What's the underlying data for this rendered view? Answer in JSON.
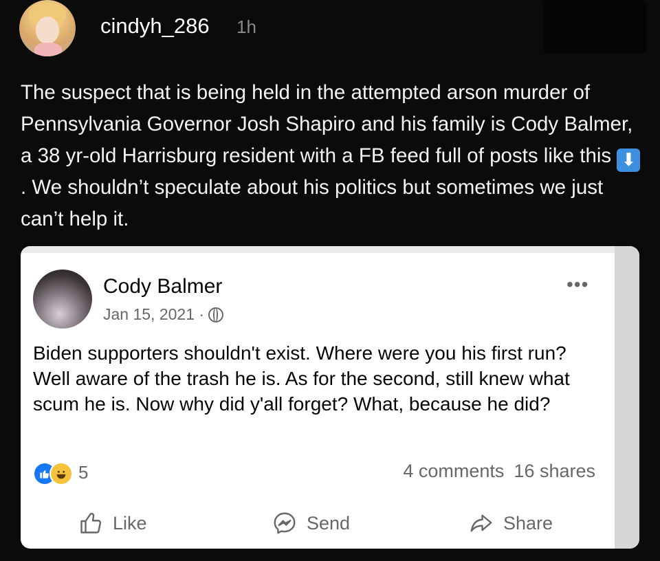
{
  "post": {
    "username": "cindyh_286",
    "time_ago": "1h",
    "caption_part1": "The suspect that is being held in the attempted arson murder of Pennsylvania Governor Josh Shapiro and his family is Cody Balmer, a 38 yr-old Harrisburg resident with a FB feed full of posts like this ",
    "caption_emoji": "⬇",
    "caption_part2": ". We shouldn’t speculate about his politics but sometimes we just can’t help it."
  },
  "embedded": {
    "author": "Cody Balmer",
    "date": "Jan 15, 2021 ·",
    "more_label": "•••",
    "text": "Biden supporters shouldn't exist. Where were you his first run? Well aware of the trash he is. As for the second, still knew what scum he is. Now why did y'all forget? What, because he did?",
    "reaction_count": "5",
    "comments": "4 comments",
    "shares": "16 shares",
    "actions": {
      "like": "Like",
      "send": "Send",
      "share": "Share"
    }
  },
  "colors": {
    "background": "#0b0b0b",
    "card": "#ffffff",
    "muted": "#65676b",
    "like_blue": "#1877f2"
  }
}
